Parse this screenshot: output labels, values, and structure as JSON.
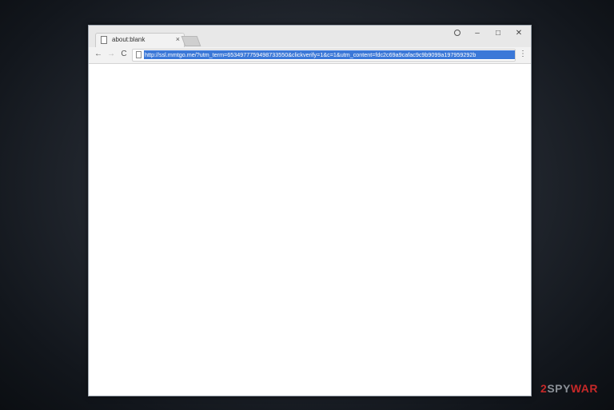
{
  "browser": {
    "tab": {
      "title": "about:blank",
      "close_glyph": "×"
    },
    "window_controls": {
      "minimize": "–",
      "maximize": "□",
      "close": "✕"
    },
    "toolbar": {
      "back_glyph": "←",
      "forward_glyph": "→",
      "reload_glyph": "C",
      "menu_glyph": "⋮",
      "address_url": "http://ssl.mmtgo.me/?utm_term=6534977759498733550&clickverify=1&c=1&utm_content=fdc2c69a9cafac9c9b9099a197959292b"
    },
    "icons": [
      "doc-icon",
      "profile-icon",
      "page-icon",
      "back-arrow-icon",
      "forward-arrow-icon",
      "reload-icon",
      "menu-icon"
    ]
  },
  "watermark": {
    "part1": "2",
    "part2": "SPY",
    "part3": "WAR"
  }
}
